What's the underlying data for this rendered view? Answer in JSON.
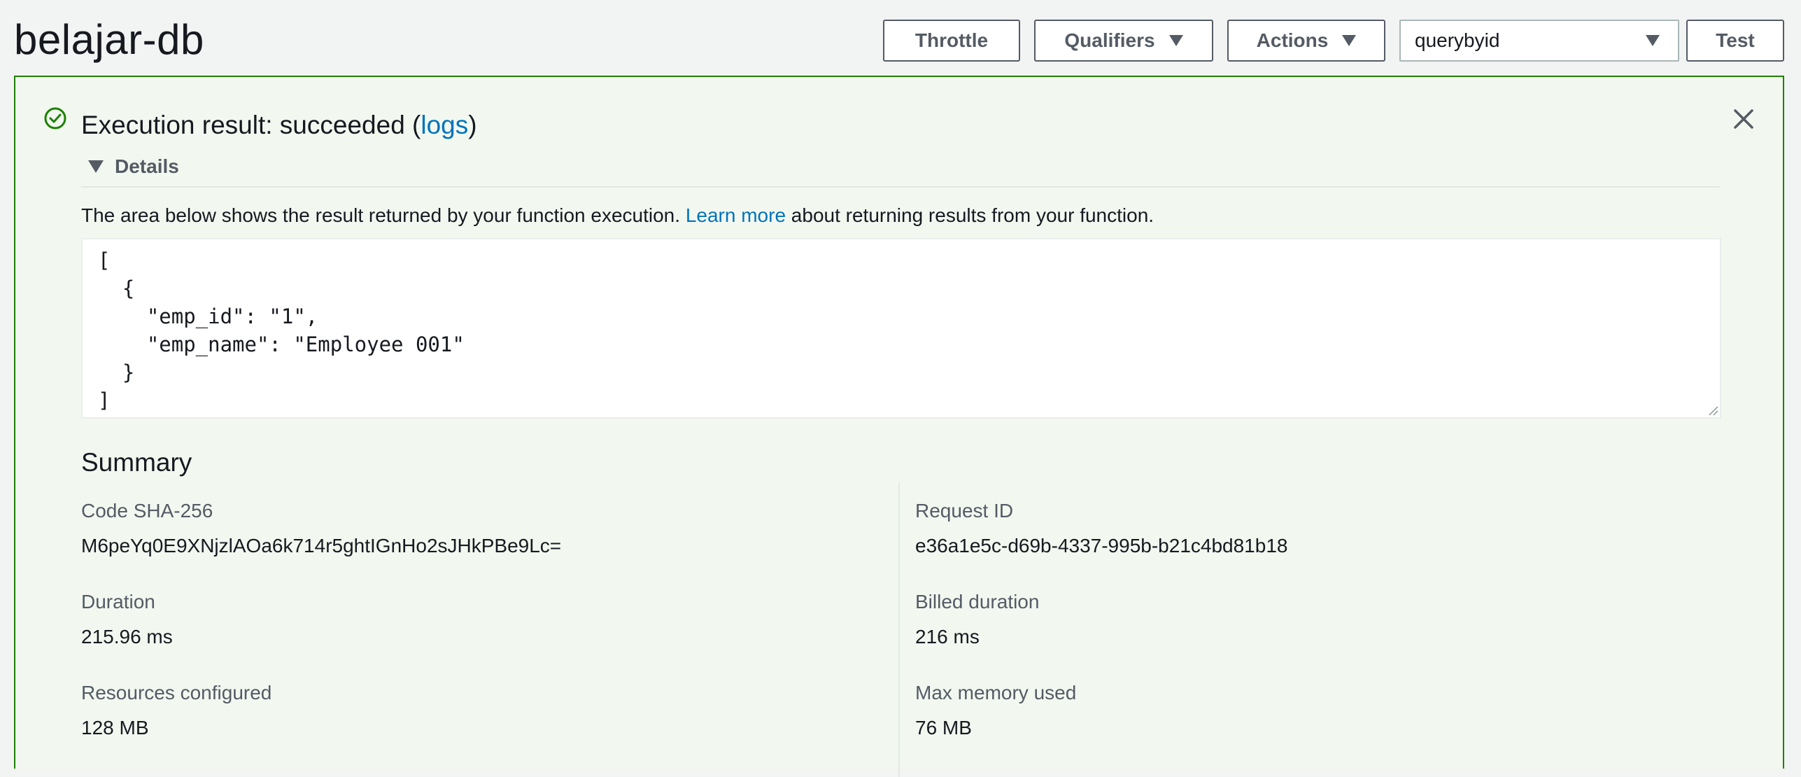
{
  "header": {
    "title": "belajar-db",
    "buttons": {
      "throttle": "Throttle",
      "qualifiers": "Qualifiers",
      "actions": "Actions",
      "test": "Test"
    },
    "test_event_select": {
      "value": "querybyid"
    }
  },
  "result": {
    "title_prefix": "Execution result: succeeded (",
    "logs_link": "logs",
    "title_suffix": ")",
    "details_label": "Details",
    "description_prefix": "The area below shows the result returned by your function execution. ",
    "learn_more_link": "Learn more",
    "description_suffix": " about returning results from your function.",
    "output": "[\n  {\n    \"emp_id\": \"1\",\n    \"emp_name\": \"Employee 001\"\n  }\n]"
  },
  "summary": {
    "title": "Summary",
    "left": [
      {
        "label": "Code SHA-256",
        "value": "M6peYq0E9XNjzlAOa6k714r5ghtIGnHo2sJHkPBe9Lc="
      },
      {
        "label": "Duration",
        "value": "215.96 ms"
      },
      {
        "label": "Resources configured",
        "value": "128 MB"
      }
    ],
    "right": [
      {
        "label": "Request ID",
        "value": "e36a1e5c-d69b-4337-995b-b21c4bd81b18"
      },
      {
        "label": "Billed duration",
        "value": "216 ms"
      },
      {
        "label": "Max memory used",
        "value": "76 MB"
      }
    ]
  },
  "icons": {
    "status": "check-circle-icon",
    "close": "close-icon",
    "dropdown": "caret-down-icon"
  },
  "colors": {
    "success_border": "#1d8102",
    "success_background": "#f2f8f0",
    "link": "#0073bb",
    "page_background": "#f2f3f3"
  }
}
